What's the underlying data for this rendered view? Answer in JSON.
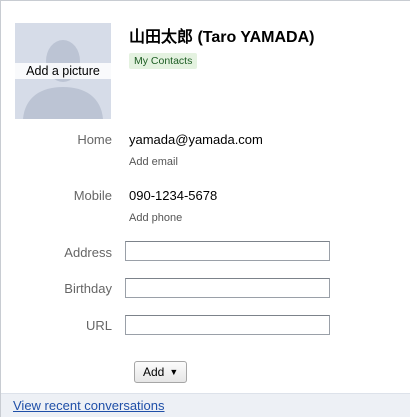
{
  "contact": {
    "photo_label": "Add a picture",
    "name": "山田太郎 (Taro YAMADA)",
    "group_badge": "My Contacts"
  },
  "fields": {
    "email": {
      "label": "Home",
      "value": "yamada@yamada.com",
      "add_label": "Add email"
    },
    "phone": {
      "label": "Mobile",
      "value": "090-1234-5678",
      "add_label": "Add phone"
    },
    "address": {
      "label": "Address",
      "value": ""
    },
    "birthday": {
      "label": "Birthday",
      "value": ""
    },
    "url": {
      "label": "URL",
      "value": ""
    }
  },
  "actions": {
    "add_button_label": "Add",
    "add_button_icon": "dropdown-caret-icon"
  },
  "footer": {
    "link_label": "View recent conversations"
  },
  "colors": {
    "badge_background": "#e4f2e0",
    "badge_text": "#1d5d23",
    "link": "#1f4fa8",
    "footer_background": "#edf0f5",
    "photo_background": "#d6dce8"
  }
}
